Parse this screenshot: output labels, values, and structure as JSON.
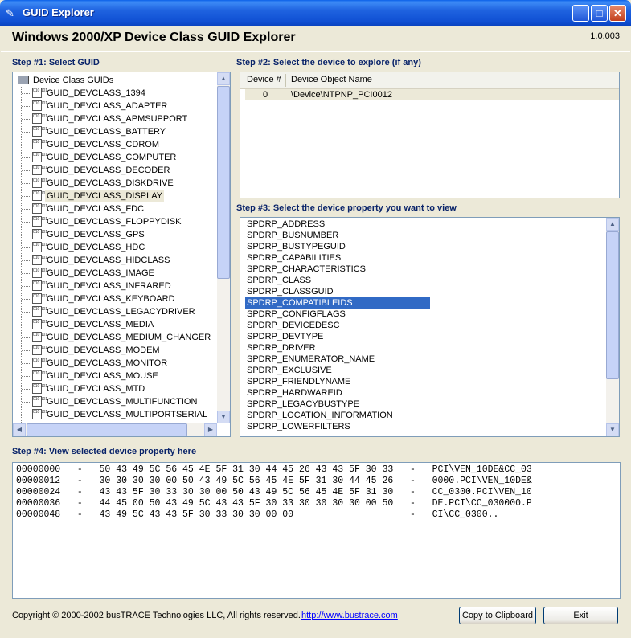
{
  "window": {
    "title": "GUID Explorer"
  },
  "app": {
    "heading": "Windows 2000/XP Device Class GUID Explorer",
    "version": "1.0.003"
  },
  "steps": {
    "s1": "Step #1:  Select GUID",
    "s2": "Step #2:  Select the device to explore (if any)",
    "s3": "Step #3:  Select the device property you want to view",
    "s4": "Step #4:  View selected device property here"
  },
  "tree": {
    "root": "Device Class GUIDs",
    "items": [
      "GUID_DEVCLASS_1394",
      "GUID_DEVCLASS_ADAPTER",
      "GUID_DEVCLASS_APMSUPPORT",
      "GUID_DEVCLASS_BATTERY",
      "GUID_DEVCLASS_CDROM",
      "GUID_DEVCLASS_COMPUTER",
      "GUID_DEVCLASS_DECODER",
      "GUID_DEVCLASS_DISKDRIVE",
      "GUID_DEVCLASS_DISPLAY",
      "GUID_DEVCLASS_FDC",
      "GUID_DEVCLASS_FLOPPYDISK",
      "GUID_DEVCLASS_GPS",
      "GUID_DEVCLASS_HDC",
      "GUID_DEVCLASS_HIDCLASS",
      "GUID_DEVCLASS_IMAGE",
      "GUID_DEVCLASS_INFRARED",
      "GUID_DEVCLASS_KEYBOARD",
      "GUID_DEVCLASS_LEGACYDRIVER",
      "GUID_DEVCLASS_MEDIA",
      "GUID_DEVCLASS_MEDIUM_CHANGER",
      "GUID_DEVCLASS_MODEM",
      "GUID_DEVCLASS_MONITOR",
      "GUID_DEVCLASS_MOUSE",
      "GUID_DEVCLASS_MTD",
      "GUID_DEVCLASS_MULTIFUNCTION",
      "GUID_DEVCLASS_MULTIPORTSERIAL"
    ],
    "selected_index": 8
  },
  "devices": {
    "headers": [
      "Device #",
      "Device Object Name"
    ],
    "rows": [
      {
        "num": "0",
        "name": "\\Device\\NTPNP_PCI0012"
      }
    ]
  },
  "properties": {
    "items": [
      "SPDRP_ADDRESS",
      "SPDRP_BUSNUMBER",
      "SPDRP_BUSTYPEGUID",
      "SPDRP_CAPABILITIES",
      "SPDRP_CHARACTERISTICS",
      "SPDRP_CLASS",
      "SPDRP_CLASSGUID",
      "SPDRP_COMPATIBLEIDS",
      "SPDRP_CONFIGFLAGS",
      "SPDRP_DEVICEDESC",
      "SPDRP_DEVTYPE",
      "SPDRP_DRIVER",
      "SPDRP_ENUMERATOR_NAME",
      "SPDRP_EXCLUSIVE",
      "SPDRP_FRIENDLYNAME",
      "SPDRP_HARDWAREID",
      "SPDRP_LEGACYBUSTYPE",
      "SPDRP_LOCATION_INFORMATION",
      "SPDRP_LOWERFILTERS"
    ],
    "selected_index": 7
  },
  "hexdump": {
    "lines": [
      "00000000   -   50 43 49 5C 56 45 4E 5F 31 30 44 45 26 43 43 5F 30 33   -   PCI\\VEN_10DE&CC_03",
      "00000012   -   30 30 30 30 00 50 43 49 5C 56 45 4E 5F 31 30 44 45 26   -   0000.PCI\\VEN_10DE&",
      "00000024   -   43 43 5F 30 33 30 30 00 50 43 49 5C 56 45 4E 5F 31 30   -   CC_0300.PCI\\VEN_10",
      "00000036   -   44 45 00 50 43 49 5C 43 43 5F 30 33 30 30 30 30 00 50   -   DE.PCI\\CC_030000.P",
      "00000048   -   43 49 5C 43 43 5F 30 33 30 30 00 00                     -   CI\\CC_0300.."
    ]
  },
  "footer": {
    "copyright": "Copyright © 2000-2002 busTRACE Technologies LLC,  All rights reserved.",
    "link": "http://www.bustrace.com",
    "copy_button": "Copy to Clipboard",
    "exit_button": "Exit"
  },
  "colors": {
    "selection": "#316AC5",
    "step_label": "#0A246A",
    "titlebar": "#0F4FD3"
  }
}
